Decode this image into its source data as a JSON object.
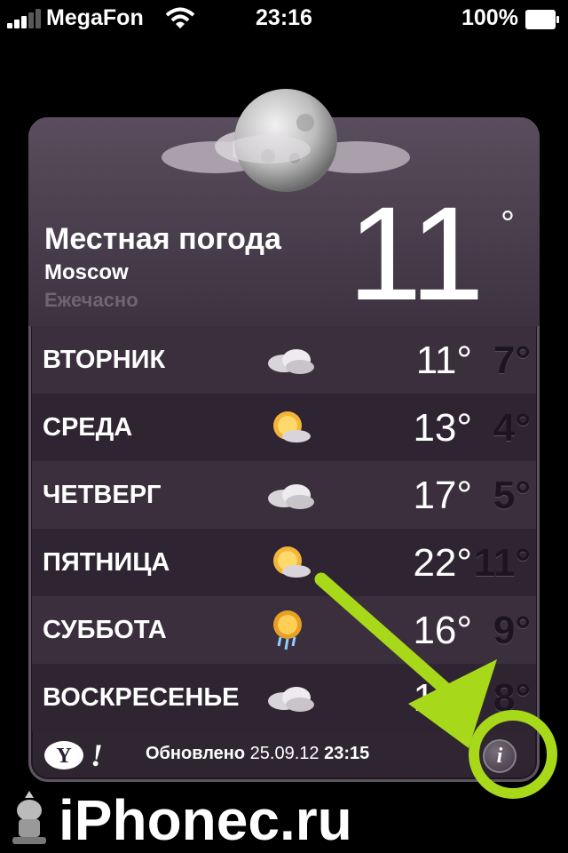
{
  "status": {
    "carrier": "MegaFon",
    "time": "23:16",
    "battery": "100%"
  },
  "city": {
    "name": "Местная погода",
    "location": "Moscow",
    "mode": "Ежечасно",
    "temp": "11",
    "degree": "°",
    "condition_icon": "moon-cloud-icon"
  },
  "forecast": [
    {
      "day": "ВТОРНИК",
      "hi": "11°",
      "lo": "7°",
      "icon": "cloud-icon"
    },
    {
      "day": "СРЕДА",
      "hi": "13°",
      "lo": "4°",
      "icon": "sun-cloud-icon"
    },
    {
      "day": "ЧЕТВЕРГ",
      "hi": "17°",
      "lo": "5°",
      "icon": "cloud-icon"
    },
    {
      "day": "ПЯТНИЦА",
      "hi": "22°",
      "lo": "11°",
      "icon": "sun-cloud-icon"
    },
    {
      "day": "СУББОТА",
      "hi": "16°",
      "lo": "9°",
      "icon": "sun-rain-icon"
    },
    {
      "day": "ВОСКРЕСЕНЬЕ",
      "hi": "15°",
      "lo": "8°",
      "icon": "cloud-icon"
    }
  ],
  "footer": {
    "logo": "Y!",
    "updated_label": "Обновлено",
    "updated_date": "25.09.12",
    "updated_time": "23:15",
    "info_label": "i"
  },
  "watermark": {
    "text": "iPhonec.ru"
  },
  "colors": {
    "annotation": "#a8d81a"
  }
}
